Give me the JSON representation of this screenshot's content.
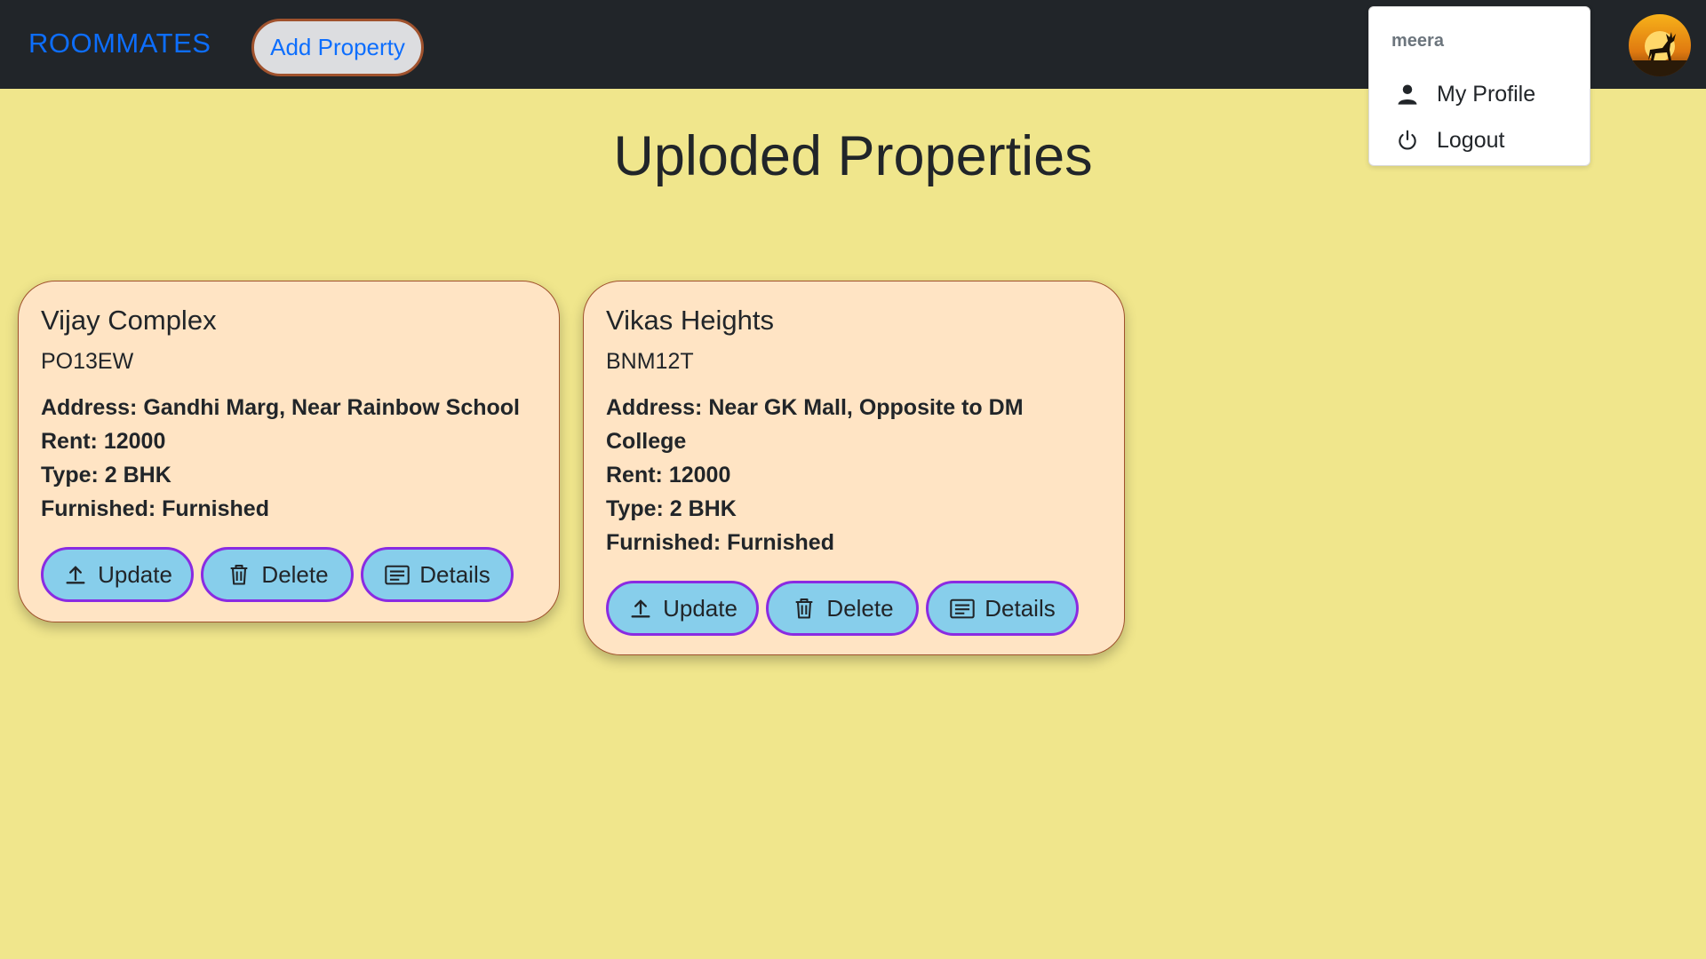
{
  "navbar": {
    "brand": "ROOMMATES",
    "add_property_label": "Add Property",
    "avatar_icon": "deer-sunset-avatar"
  },
  "dropdown": {
    "username": "meera",
    "items": [
      {
        "label": "My Profile",
        "icon": "person-icon"
      },
      {
        "label": "Logout",
        "icon": "power-icon"
      }
    ]
  },
  "page": {
    "title": "Uploded Properties"
  },
  "properties": [
    {
      "name": "Vijay Complex",
      "code": "PO13EW",
      "address_label": "Address:",
      "address": "Gandhi Marg, Near Rainbow School",
      "rent_label": "Rent:",
      "rent": "12000",
      "type_label": "Type:",
      "type": "2 BHK",
      "furnished_label": "Furnished:",
      "furnished": "Furnished"
    },
    {
      "name": "Vikas Heights",
      "code": "BNM12T",
      "address_label": "Address:",
      "address": "Near GK Mall, Opposite to DM College",
      "rent_label": "Rent:",
      "rent": "12000",
      "type_label": "Type:",
      "type": "2 BHK",
      "furnished_label": "Furnished:",
      "furnished": "Furnished"
    }
  ],
  "card_buttons": {
    "update": "Update",
    "delete": "Delete",
    "details": "Details"
  },
  "colors": {
    "page_bg": "#f0e68c",
    "navbar_bg": "#212529",
    "brand": "#0d6efd",
    "card_bg": "#ffe4c4",
    "card_border": "#a0522d",
    "button_bg": "#87ceeb",
    "button_border": "#8a2be2"
  }
}
